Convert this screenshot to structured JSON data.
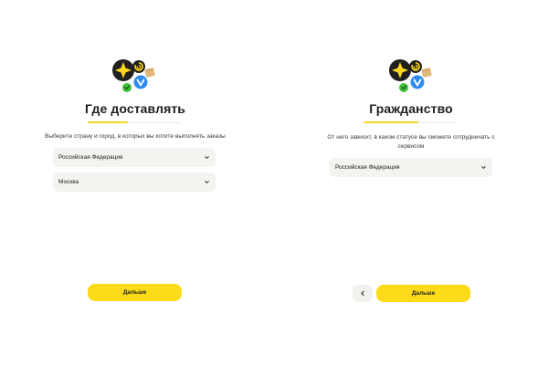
{
  "colors": {
    "accent": "#fcdb19",
    "field_bg": "#f4f3f0",
    "text": "#21201f"
  },
  "step_location": {
    "logo_icon": "yandex-services-logo-icon",
    "title": "Где доставлять",
    "subtitle": "Выберите страну и город, в которых вы хотите выполнять заказы",
    "country_select": {
      "value": "Российская Федерация",
      "icon": "chevron-down-icon"
    },
    "city_select": {
      "value": "Москва",
      "icon": "chevron-down-icon"
    },
    "next_button_label": "Дальше"
  },
  "step_citizenship": {
    "logo_icon": "yandex-services-logo-icon",
    "title": "Гражданство",
    "subtitle": "От него зависит, в каком статусе вы сможете сотрудничать с сервисом",
    "citizenship_select": {
      "value": "Российская Федерация",
      "icon": "chevron-down-icon"
    },
    "back_button_icon": "chevron-left-icon",
    "next_button_label": "Дальше"
  }
}
